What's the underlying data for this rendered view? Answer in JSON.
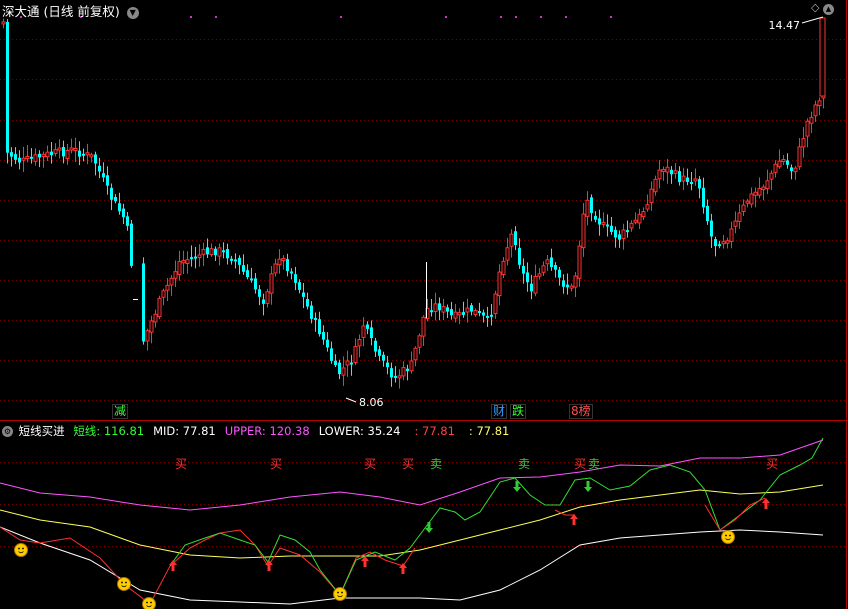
{
  "header": {
    "title": "深大通 (日线 前复权)",
    "colors": {
      "title": "#ffffff"
    }
  },
  "main_chart": {
    "price_high_label": "14.47",
    "price_low_label": "8.06",
    "event_markers": [
      {
        "text": "减",
        "color": "#33ff33"
      },
      {
        "text": "财",
        "color": "#3399ff"
      },
      {
        "text": "跌",
        "color": "#33ff33"
      },
      {
        "text": "8榜",
        "color": "#ff5050"
      }
    ],
    "colors": {
      "up": "#ff3232",
      "down": "#00ffff",
      "grid": "#8b0000"
    }
  },
  "indicator": {
    "name": "短线买进",
    "fields": [
      {
        "label": "短线:",
        "value": "116.81",
        "color": "#33ff33"
      },
      {
        "label": "MID:",
        "value": "77.81",
        "color": "#ffffff"
      },
      {
        "label": "UPPER:",
        "value": "120.38",
        "color": "#ff55ff"
      },
      {
        "label": "LOWER:",
        "value": "35.24",
        "color": "#ffffff"
      },
      {
        "label": ":",
        "value": "77.81",
        "color": "#ff4444"
      },
      {
        "label": ":",
        "value": "77.81",
        "color": "#ffff66"
      }
    ],
    "signals": {
      "buy_text": "买",
      "sell_text": "卖",
      "buy_color": "#ff3030",
      "sell_color": "#33cc33"
    },
    "line_colors": {
      "upper": "#ff55ff",
      "mid": "#ffff55",
      "lower": "#ffffff",
      "short": "#33dd33",
      "short_low": "#ff3030"
    }
  }
}
